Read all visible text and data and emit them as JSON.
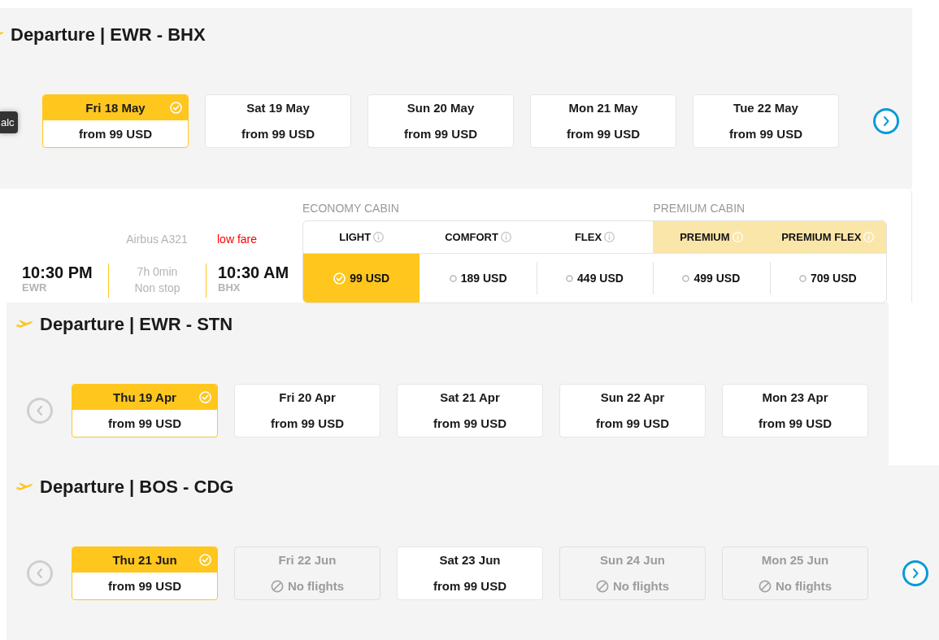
{
  "sections": [
    {
      "kind": "dates",
      "title": "Departure | EWR - BHX",
      "tooltip": "alc",
      "next_button": {
        "disabled": false
      },
      "dates": [
        {
          "label": "Fri 18 May",
          "price": "from 99 USD",
          "selected": true,
          "disabled": false
        },
        {
          "label": "Sat 19 May",
          "price": "from 99 USD",
          "selected": false,
          "disabled": false
        },
        {
          "label": "Sun 20 May",
          "price": "from 99 USD",
          "selected": false,
          "disabled": false
        },
        {
          "label": "Mon 21 May",
          "price": "from 99 USD",
          "selected": false,
          "disabled": false
        },
        {
          "label": "Tue 22 May",
          "price": "from 99 USD",
          "selected": false,
          "disabled": false
        }
      ]
    },
    {
      "kind": "flight",
      "aircraft": "Airbus A321",
      "fare_note": "low fare",
      "departure": {
        "time": "10:30 PM",
        "airport": "EWR"
      },
      "duration": "7h 0min",
      "stops": "Non stop",
      "arrival": {
        "time": "10:30 AM",
        "airport": "BHX"
      },
      "cabins": [
        {
          "label": "ECONOMY CABIN",
          "highlighted": false,
          "fares": [
            {
              "name": "LIGHT",
              "price": "99 USD",
              "selected": true
            },
            {
              "name": "COMFORT",
              "price": "189 USD",
              "selected": false
            },
            {
              "name": "FLEX",
              "price": "449 USD",
              "selected": false
            }
          ]
        },
        {
          "label": "PREMIUM CABIN",
          "highlighted": true,
          "fares": [
            {
              "name": "PREMIUM",
              "price": "499 USD",
              "selected": false
            },
            {
              "name": "PREMIUM FLEX",
              "price": "709 USD",
              "selected": false
            }
          ]
        }
      ]
    },
    {
      "kind": "dates",
      "title": "Departure | EWR - STN",
      "prev_button": {
        "disabled": true
      },
      "dates": [
        {
          "label": "Thu 19 Apr",
          "price": "from 99 USD",
          "selected": true,
          "disabled": false
        },
        {
          "label": "Fri 20 Apr",
          "price": "from 99 USD",
          "selected": false,
          "disabled": false
        },
        {
          "label": "Sat 21 Apr",
          "price": "from 99 USD",
          "selected": false,
          "disabled": false
        },
        {
          "label": "Sun 22 Apr",
          "price": "from 99 USD",
          "selected": false,
          "disabled": false
        },
        {
          "label": "Mon 23 Apr",
          "price": "from 99 USD",
          "selected": false,
          "disabled": false
        }
      ]
    },
    {
      "kind": "dates",
      "title": "Departure | BOS - CDG",
      "prev_button": {
        "disabled": true
      },
      "next_button": {
        "disabled": false
      },
      "dates": [
        {
          "label": "Thu 21 Jun",
          "price": "from 99 USD",
          "selected": true,
          "disabled": false
        },
        {
          "label": "Fri 22 Jun",
          "price": "No flights",
          "selected": false,
          "disabled": true
        },
        {
          "label": "Sat 23 Jun",
          "price": "from 99 USD",
          "selected": false,
          "disabled": false
        },
        {
          "label": "Sun 24 Jun",
          "price": "No flights",
          "selected": false,
          "disabled": true
        },
        {
          "label": "Mon 25 Jun",
          "price": "No flights",
          "selected": false,
          "disabled": true
        }
      ]
    }
  ]
}
